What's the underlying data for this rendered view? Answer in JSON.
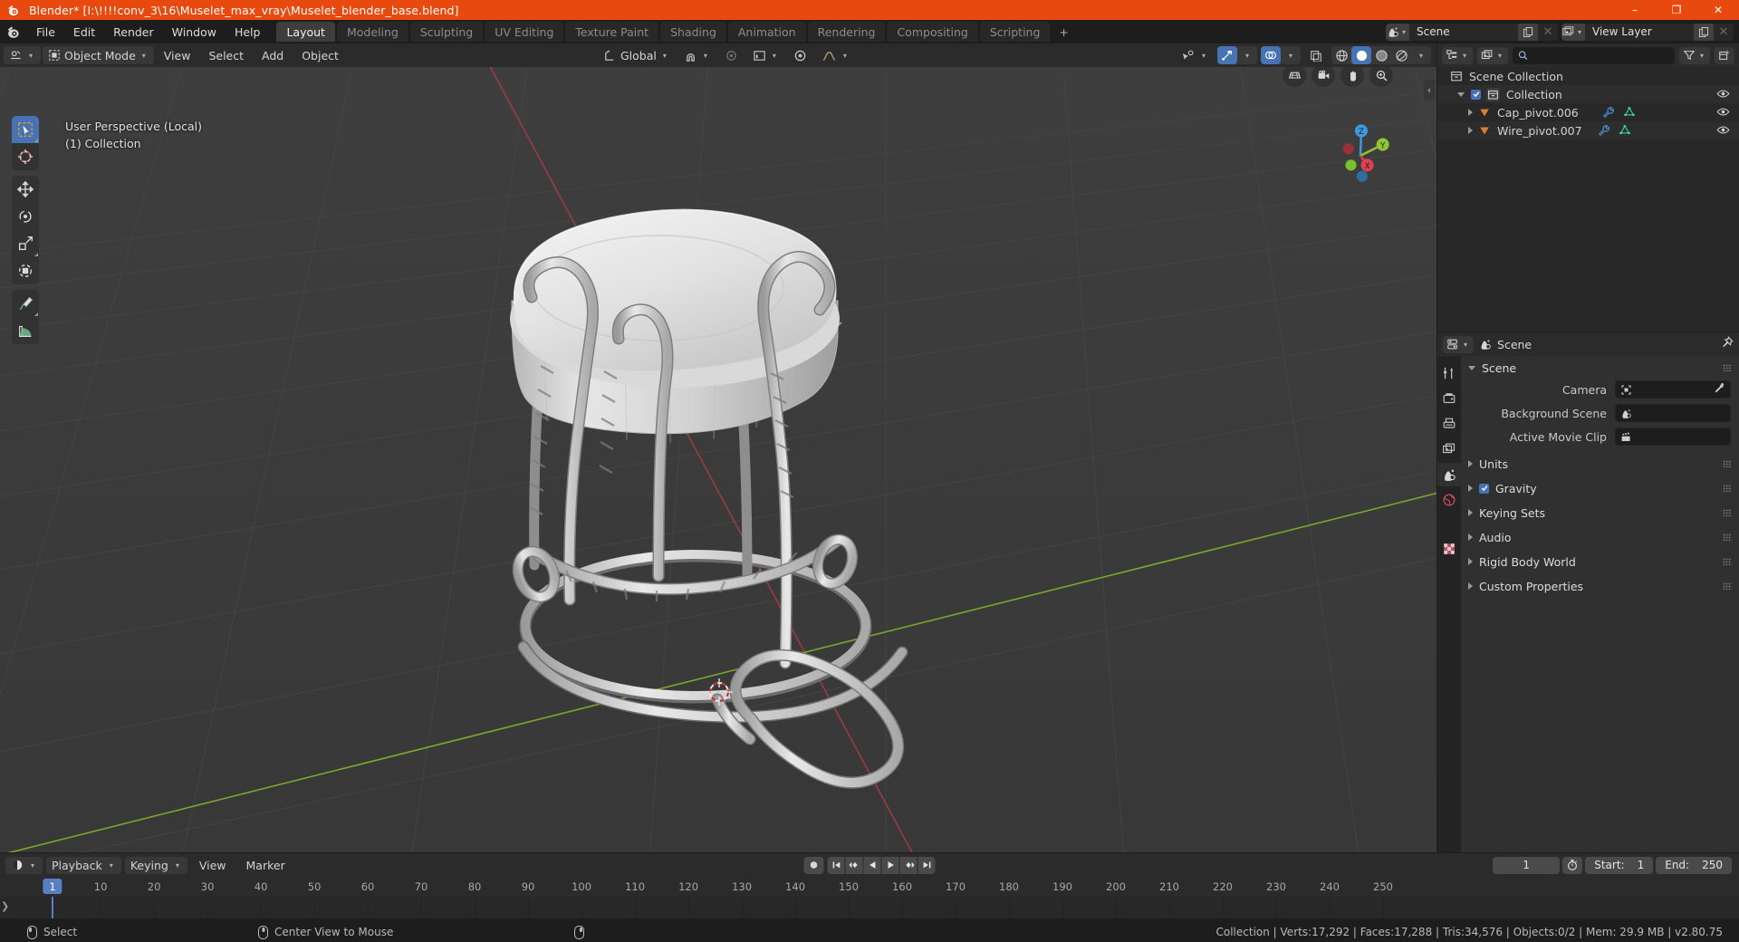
{
  "titlebar": {
    "title": "Blender* [I:\\!!!!conv_3\\16\\Muselet_max_vray\\Muselet_blender_base.blend]",
    "minimize": "–",
    "maximize": "❐",
    "close": "✕"
  },
  "topbar": {
    "menus": [
      "File",
      "Edit",
      "Render",
      "Window",
      "Help"
    ],
    "workspaces": [
      {
        "label": "Layout",
        "active": true
      },
      {
        "label": "Modeling",
        "active": false
      },
      {
        "label": "Sculpting",
        "active": false
      },
      {
        "label": "UV Editing",
        "active": false
      },
      {
        "label": "Texture Paint",
        "active": false
      },
      {
        "label": "Shading",
        "active": false
      },
      {
        "label": "Animation",
        "active": false
      },
      {
        "label": "Rendering",
        "active": false
      },
      {
        "label": "Compositing",
        "active": false
      },
      {
        "label": "Scripting",
        "active": false
      }
    ],
    "add_workspace": "+",
    "scene_name": "Scene",
    "viewlayer_name": "View Layer"
  },
  "viewport": {
    "mode": "Object Mode",
    "menus": [
      "View",
      "Select",
      "Add",
      "Object"
    ],
    "transform_orientation": "Global",
    "overlay_line1": "User Perspective (Local)",
    "overlay_line2": "(1) Collection",
    "gizmo_axes": {
      "x": "X",
      "y": "Y",
      "z": "Z"
    },
    "gizmo_colors": {
      "x": "#e0404f",
      "y": "#8fc733",
      "z": "#3b9ae1"
    }
  },
  "outliner": {
    "search_placeholder": "",
    "rows": [
      {
        "label": "Scene Collection",
        "indent": 0,
        "icon": "collection-icon",
        "has_eye": false,
        "has_checkbox": false,
        "has_disclosure": false
      },
      {
        "label": "Collection",
        "indent": 1,
        "icon": "collection-icon",
        "has_eye": true,
        "has_checkbox": true,
        "has_disclosure": true
      },
      {
        "label": "Cap_pivot.006",
        "indent": 2,
        "icon": "mesh-data-icon",
        "has_eye": true,
        "has_checkbox": false,
        "has_disclosure": false
      },
      {
        "label": "Wire_pivot.007",
        "indent": 2,
        "icon": "mesh-data-icon",
        "has_eye": true,
        "has_checkbox": false,
        "has_disclosure": false
      }
    ]
  },
  "properties": {
    "breadcrumb": "Scene",
    "panel_title": "Scene",
    "fields": [
      {
        "label": "Camera",
        "value": "",
        "icon": "camera-data-icon",
        "eyedropper": true
      },
      {
        "label": "Background Scene",
        "value": "",
        "icon": "scene-icon",
        "eyedropper": false
      },
      {
        "label": "Active Movie Clip",
        "value": "",
        "icon": "clip-icon",
        "eyedropper": false
      }
    ],
    "sections": [
      {
        "label": "Units",
        "checkbox": null
      },
      {
        "label": "Gravity",
        "checkbox": true
      },
      {
        "label": "Keying Sets",
        "checkbox": null
      },
      {
        "label": "Audio",
        "checkbox": null
      },
      {
        "label": "Rigid Body World",
        "checkbox": null
      },
      {
        "label": "Custom Properties",
        "checkbox": null
      }
    ]
  },
  "timeline": {
    "menus": [
      "View",
      "Marker"
    ],
    "dropdowns": [
      "Playback",
      "Keying"
    ],
    "current_frame": "1",
    "start_label": "Start:",
    "start_value": "1",
    "end_label": "End:",
    "end_value": "250",
    "ticks": [
      "1",
      "10",
      "20",
      "30",
      "40",
      "50",
      "60",
      "70",
      "80",
      "90",
      "100",
      "110",
      "120",
      "130",
      "140",
      "150",
      "160",
      "170",
      "180",
      "190",
      "200",
      "210",
      "220",
      "230",
      "240",
      "250"
    ],
    "playhead_frame": "1"
  },
  "statusbar": {
    "left_action": "Select",
    "middle_action": "Center View to Mouse",
    "stats": "Collection | Verts:17,292 | Faces:17,288 | Tris:34,576 | Objects:0/2 | Mem: 29.9 MB | v2.80.75"
  },
  "colors": {
    "accent_orange": "#e8490f",
    "select_blue": "#4772b3",
    "viewport_bg": "#3b3b3b",
    "axis_x_red": "#9c3a42",
    "axis_y_green": "#7aa82a"
  }
}
